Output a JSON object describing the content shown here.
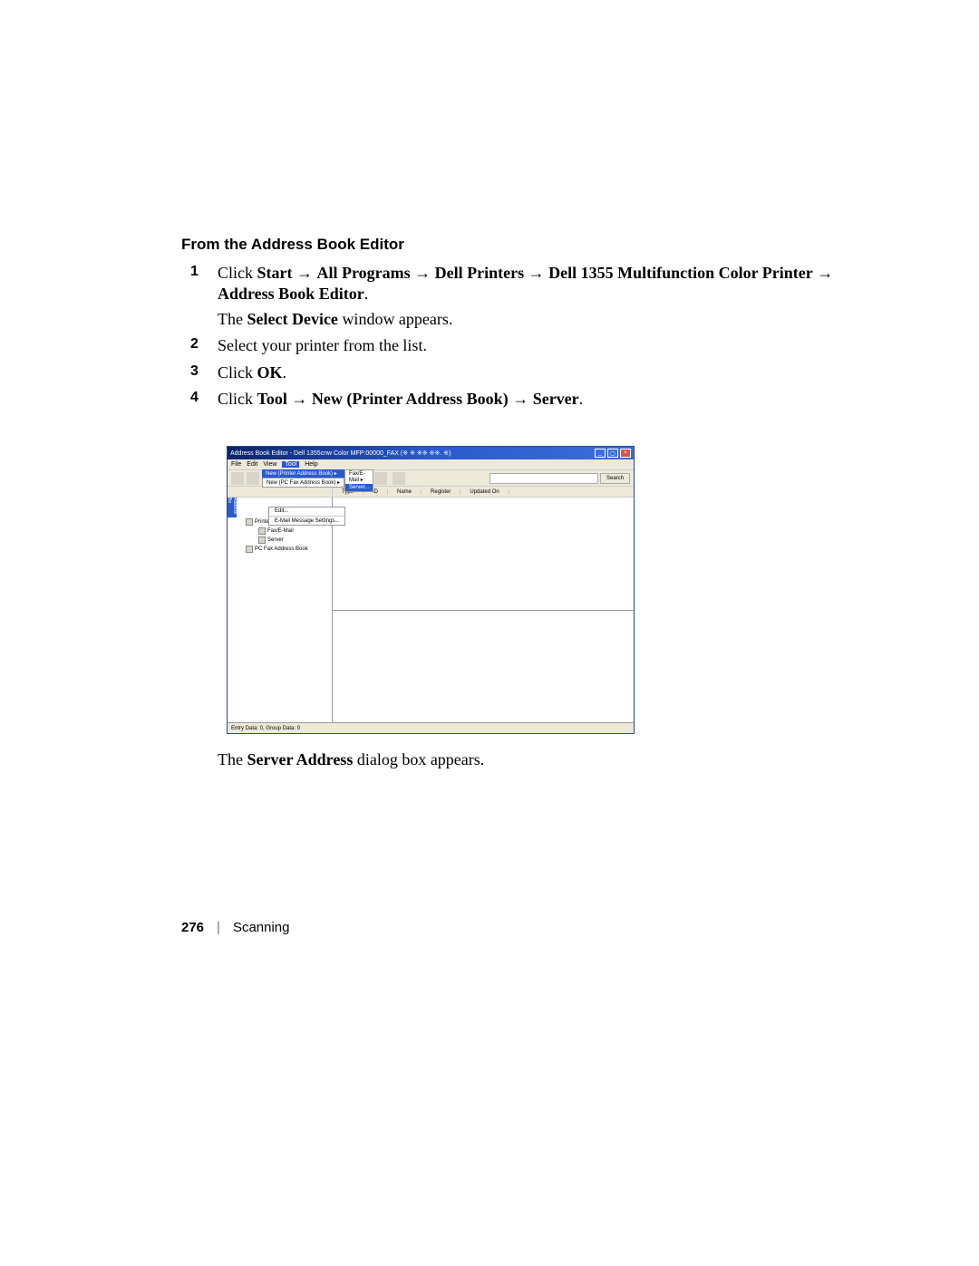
{
  "heading": "From the Address Book Editor",
  "steps": {
    "s1": {
      "prefix": "Click ",
      "path1": "Start",
      "path2": "All Programs",
      "path3": "Dell Printers",
      "path4": "Dell 1355 Multifunction Color Printer",
      "path5": "Address Book Editor",
      "after": ".",
      "sub_prefix": "The ",
      "sub_bold": "Select Device",
      "sub_suffix": " window appears."
    },
    "s2": "Select your printer from the list.",
    "s3": {
      "prefix": "Click ",
      "bold": "OK",
      "suffix": "."
    },
    "s4": {
      "prefix": "Click ",
      "p1": "Tool",
      "p2": "New (Printer Address Book)",
      "p3": "Server",
      "suffix": "."
    }
  },
  "arrow": "→",
  "screenshot": {
    "title": "Address Book Editor - Dell 1355cnw Color MFP:00000_FAX (※ ※ ※※ ※※. ※)",
    "menubar": {
      "file": "File",
      "edit": "Edit",
      "view": "View",
      "tool": "Tool",
      "help": "Help"
    },
    "tool_menu": {
      "new_printer": "New (Printer Address Book)",
      "new_pcfax": "New (PC Fax Address Book)",
      "edit": "Edit...",
      "email_settings": "E-Mail Message Settings..."
    },
    "sub_menu": {
      "fax_email": "Fax/E-Mail",
      "server": "Server..."
    },
    "toolbar": {
      "search_btn": "Search"
    },
    "columns": {
      "type": "Type",
      "id": "ID",
      "name": "Name",
      "register": "Register",
      "updated": "Updated On"
    },
    "tree": {
      "tab": "Address Bo",
      "root": "Printer Address Book",
      "fax_email": "Fax/E-Mail",
      "server": "Server",
      "pcfax": "PC Fax Address Book"
    },
    "status": "Entry Data: 0, Group Data: 0"
  },
  "caption_after": {
    "prefix": "The ",
    "bold": "Server Address",
    "suffix": " dialog box appears."
  },
  "footer": {
    "page": "276",
    "section": "Scanning"
  }
}
